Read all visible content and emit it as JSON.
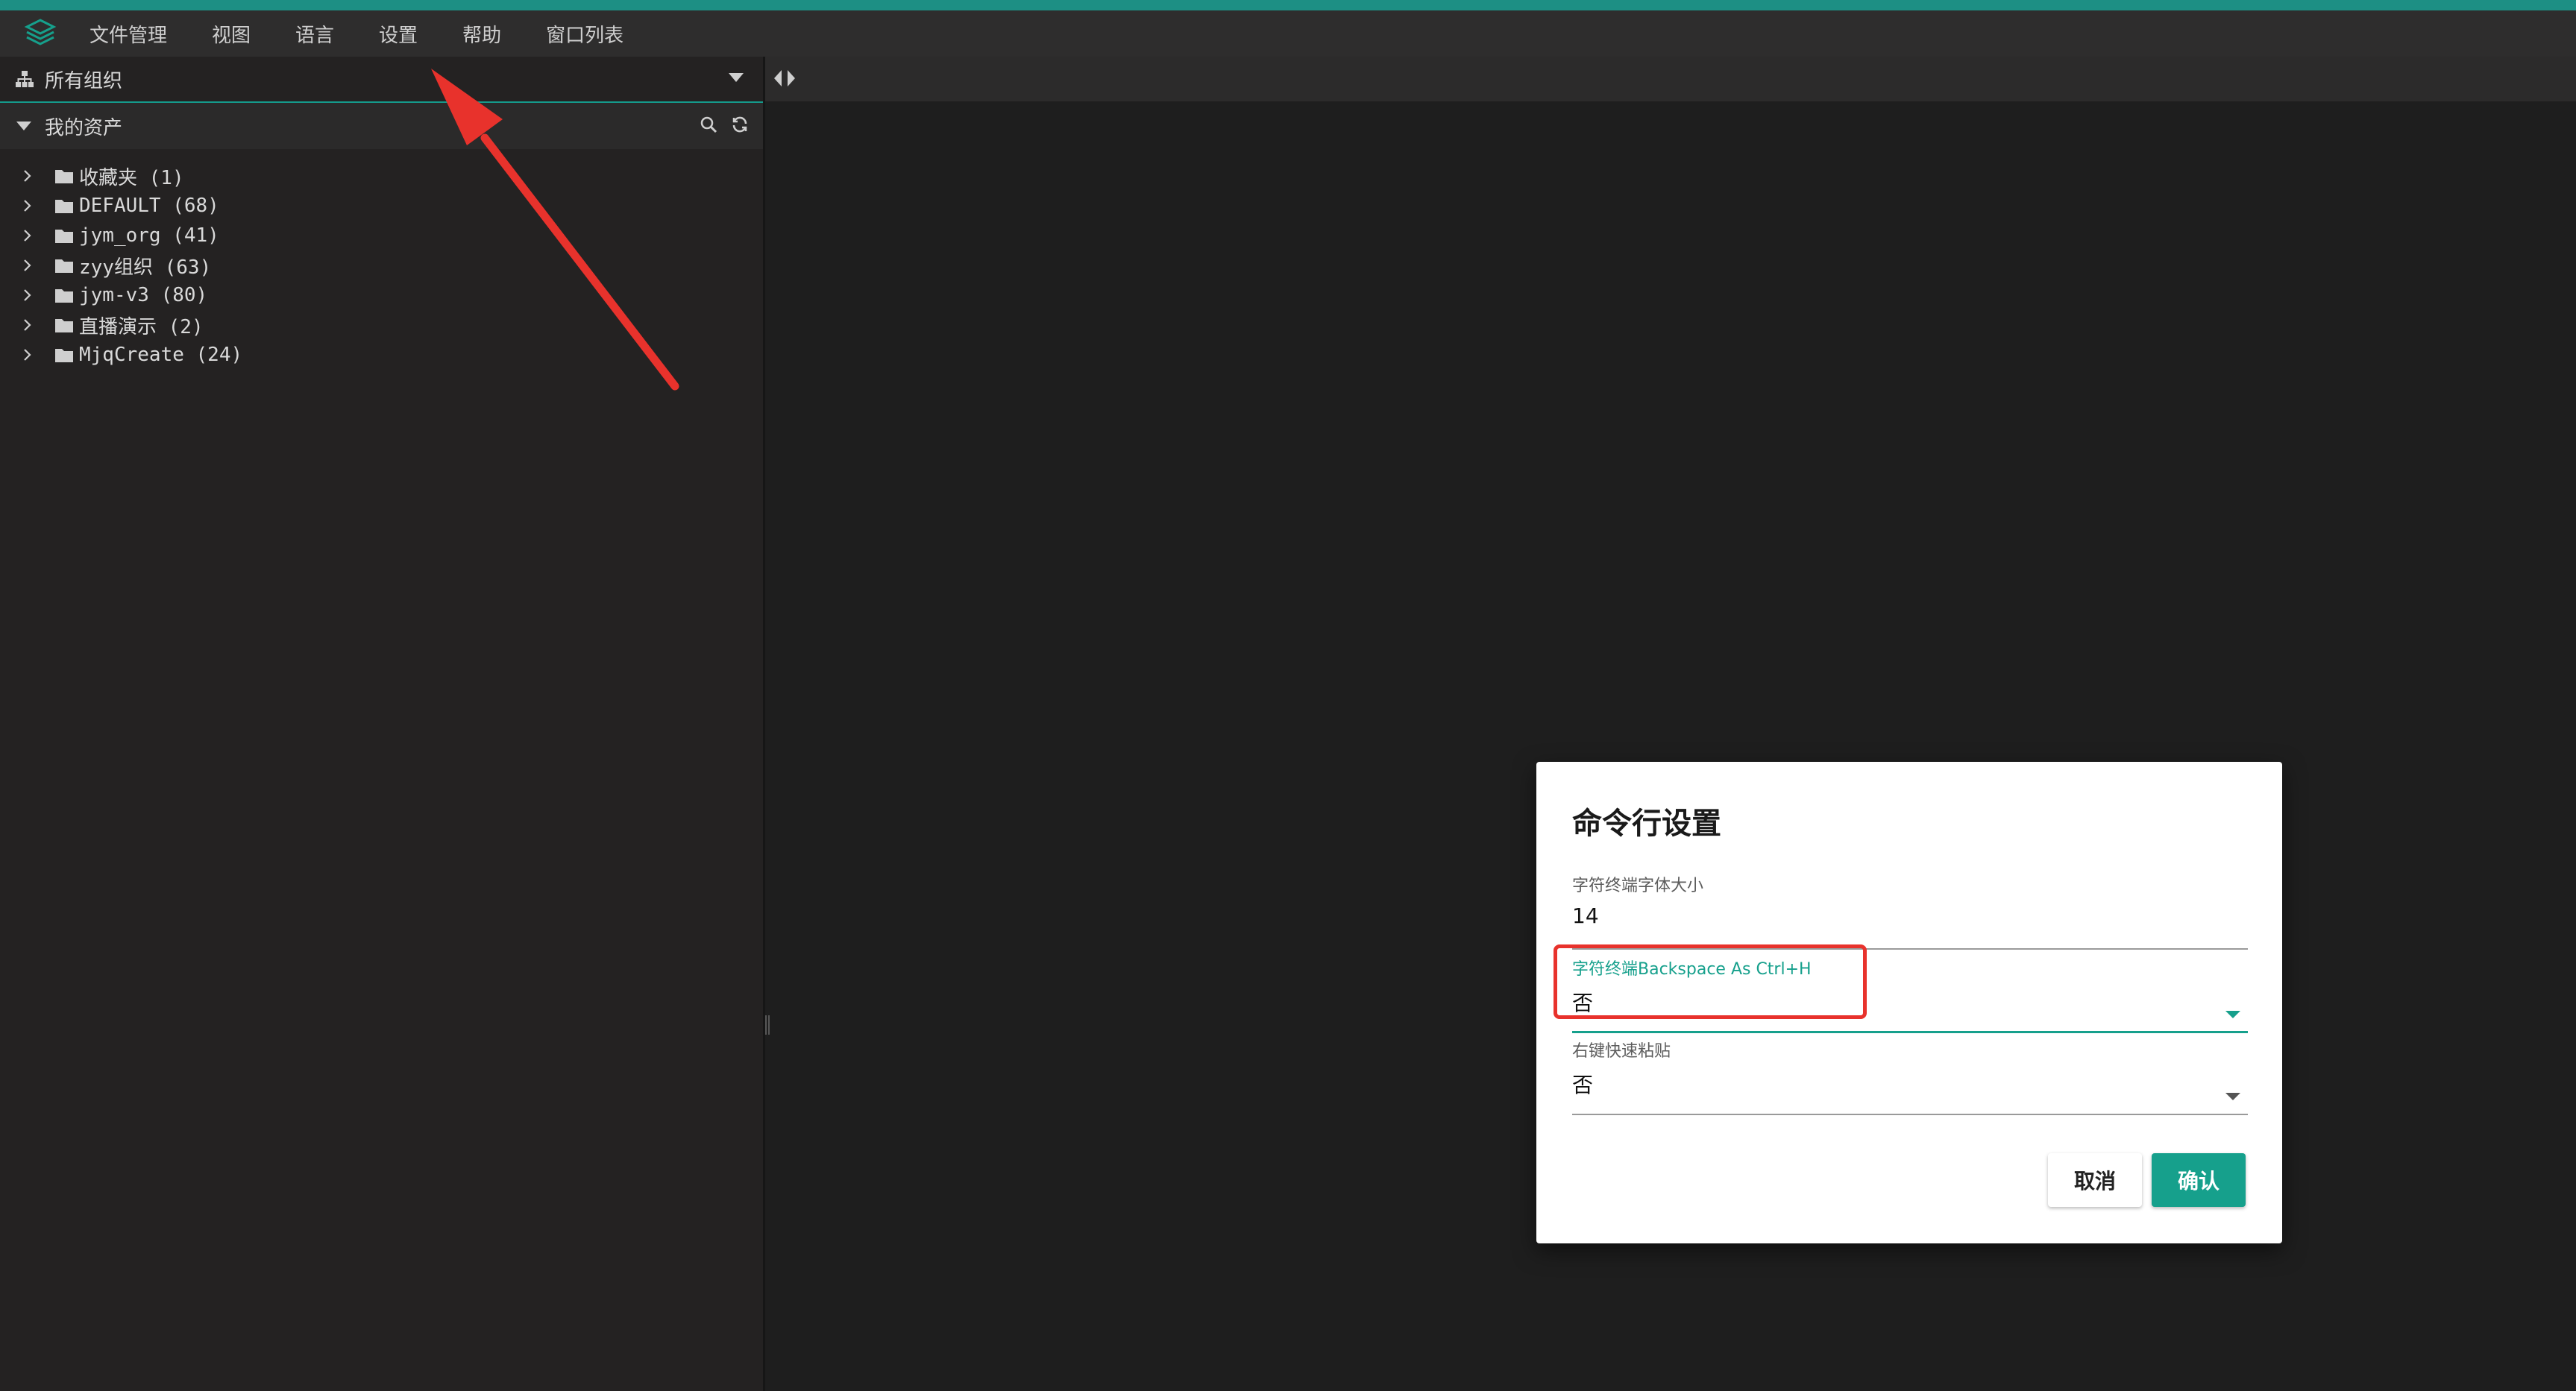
{
  "menubar": {
    "items": [
      "文件管理",
      "视图",
      "语言",
      "设置",
      "帮助",
      "窗口列表"
    ]
  },
  "sidebar": {
    "org_label": "所有组织",
    "assets_label": "我的资产",
    "tree": [
      {
        "label": "收藏夹 (1)"
      },
      {
        "label": "DEFAULT (68)"
      },
      {
        "label": "jym_org (41)"
      },
      {
        "label": "zyy组织 (63)"
      },
      {
        "label": "jym-v3 (80)"
      },
      {
        "label": "直播演示 (2)"
      },
      {
        "label": "MjqCreate (24)"
      }
    ]
  },
  "dialog": {
    "title": "命令行设置",
    "fields": [
      {
        "label": "字符终端字体大小",
        "value": "14"
      },
      {
        "label": "字符终端Backspace As Ctrl+H",
        "value": "否"
      },
      {
        "label": "右键快速粘贴",
        "value": "否"
      }
    ],
    "cancel_label": "取消",
    "confirm_label": "确认"
  },
  "colors": {
    "accent": "#16a08c",
    "annotation": "#e8322c",
    "menubar_bg": "#2e2d2d",
    "sidebar_bg": "#242222",
    "workspace_bg": "#1e1e1e"
  }
}
